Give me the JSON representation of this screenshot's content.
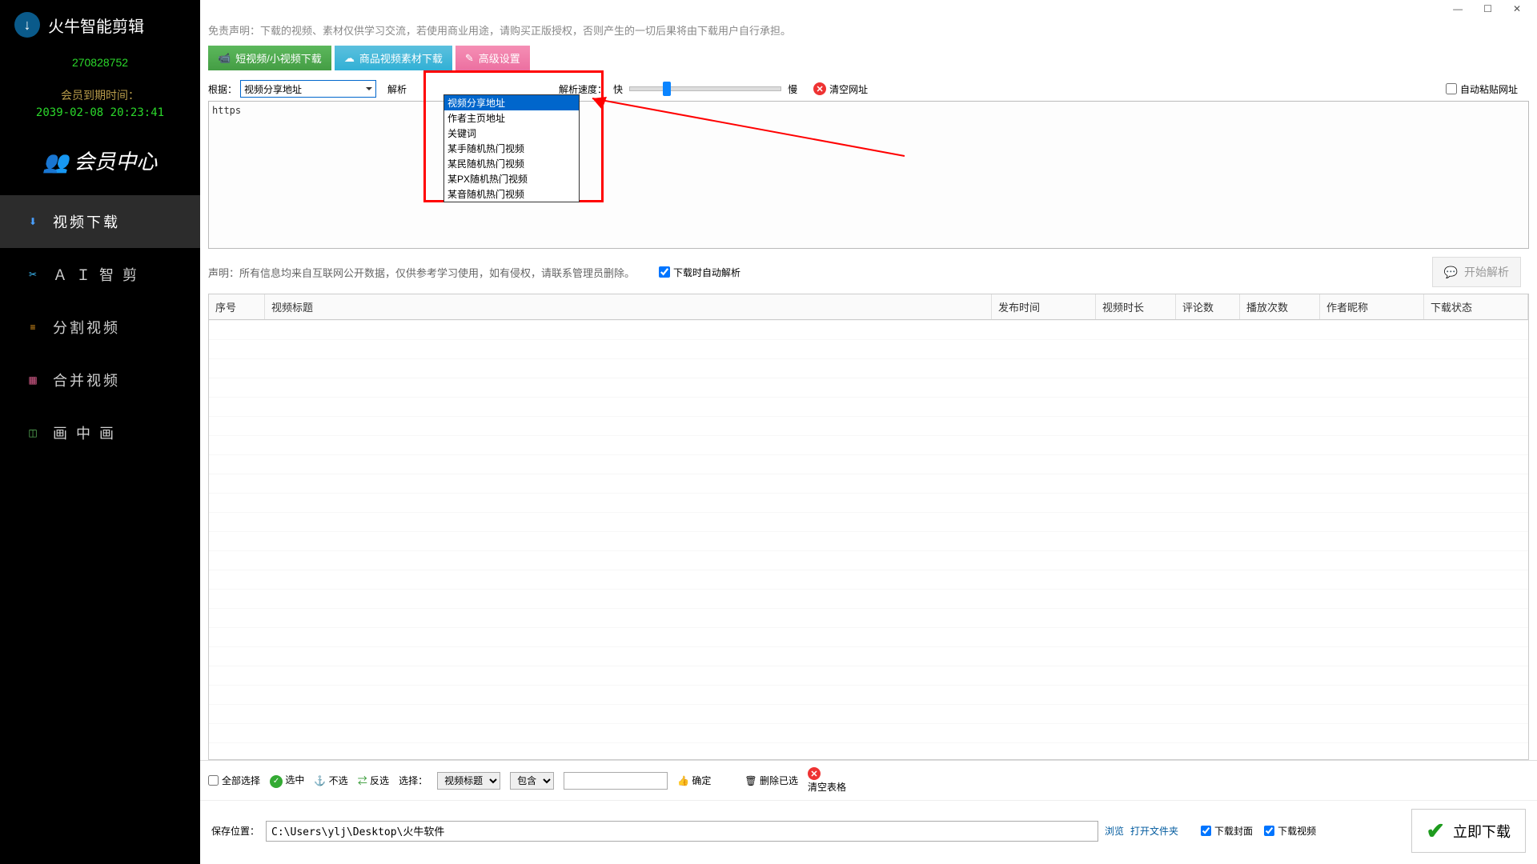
{
  "app_title": "火牛智能剪辑",
  "user_id": "270828752",
  "expire_label": "会员到期时间：",
  "expire_date": "2039-02-08 20:23:41",
  "member_center": "会员中心",
  "sidebar": {
    "items": [
      {
        "label": "视频下载"
      },
      {
        "label": "Ａ Ｉ 智 剪"
      },
      {
        "label": "分割视频"
      },
      {
        "label": "合并视频"
      },
      {
        "label": "画 中 画"
      }
    ]
  },
  "titlebar": {
    "min": "—",
    "max": "☐",
    "close": "✕"
  },
  "disclaimer": "免责声明：下载的视频、素材仅供学习交流，若使用商业用途，请购买正版授权，否则产生的一切后果将由下载用户自行承担。",
  "tabs": [
    {
      "label": "短视频/小视频下载"
    },
    {
      "label": "商品视频素材下载"
    },
    {
      "label": "高级设置"
    }
  ],
  "according_label": "根据：",
  "select_value": "视频分享地址",
  "parse_label": "解析",
  "dropdown_options": [
    "视频分享地址",
    "作者主页地址",
    "关键词",
    "某手随机热门视频",
    "某民随机热门视频",
    "某PX随机热门视频",
    "某音随机热门视频"
  ],
  "parse_speed_label": "解析速度：",
  "fast_label": "快",
  "slow_label": "慢",
  "clear_url_label": "清空网址",
  "auto_paste_label": "自动粘贴网址",
  "url_text": "https",
  "note": "声明：所有信息均来自互联网公开数据，仅供参考学习使用，如有侵权，请联系管理员删除。",
  "auto_parse_on_download": "下载时自动解析",
  "start_parse": "开始解析",
  "table_headers": [
    "序号",
    "视频标题",
    "发布时间",
    "视频时长",
    "评论数",
    "播放次数",
    "作者昵称",
    "下载状态"
  ],
  "bottom": {
    "select_all": "全部选择",
    "select_on": "选中",
    "deselect": "不选",
    "invert": "反选",
    "choose_label": "选择：",
    "choose_field": "视频标题",
    "match_type": "包含",
    "confirm": "确定",
    "delete_selected": "删除已选",
    "clear_table": "清空表格"
  },
  "footer": {
    "save_path_label": "保存位置：",
    "save_path": "C:\\Users\\ylj\\Desktop\\火牛软件",
    "browse": "浏览",
    "open_folder": "打开文件夹",
    "download_cover": "下载封面",
    "download_video": "下载视频",
    "download_now": "立即下载"
  }
}
